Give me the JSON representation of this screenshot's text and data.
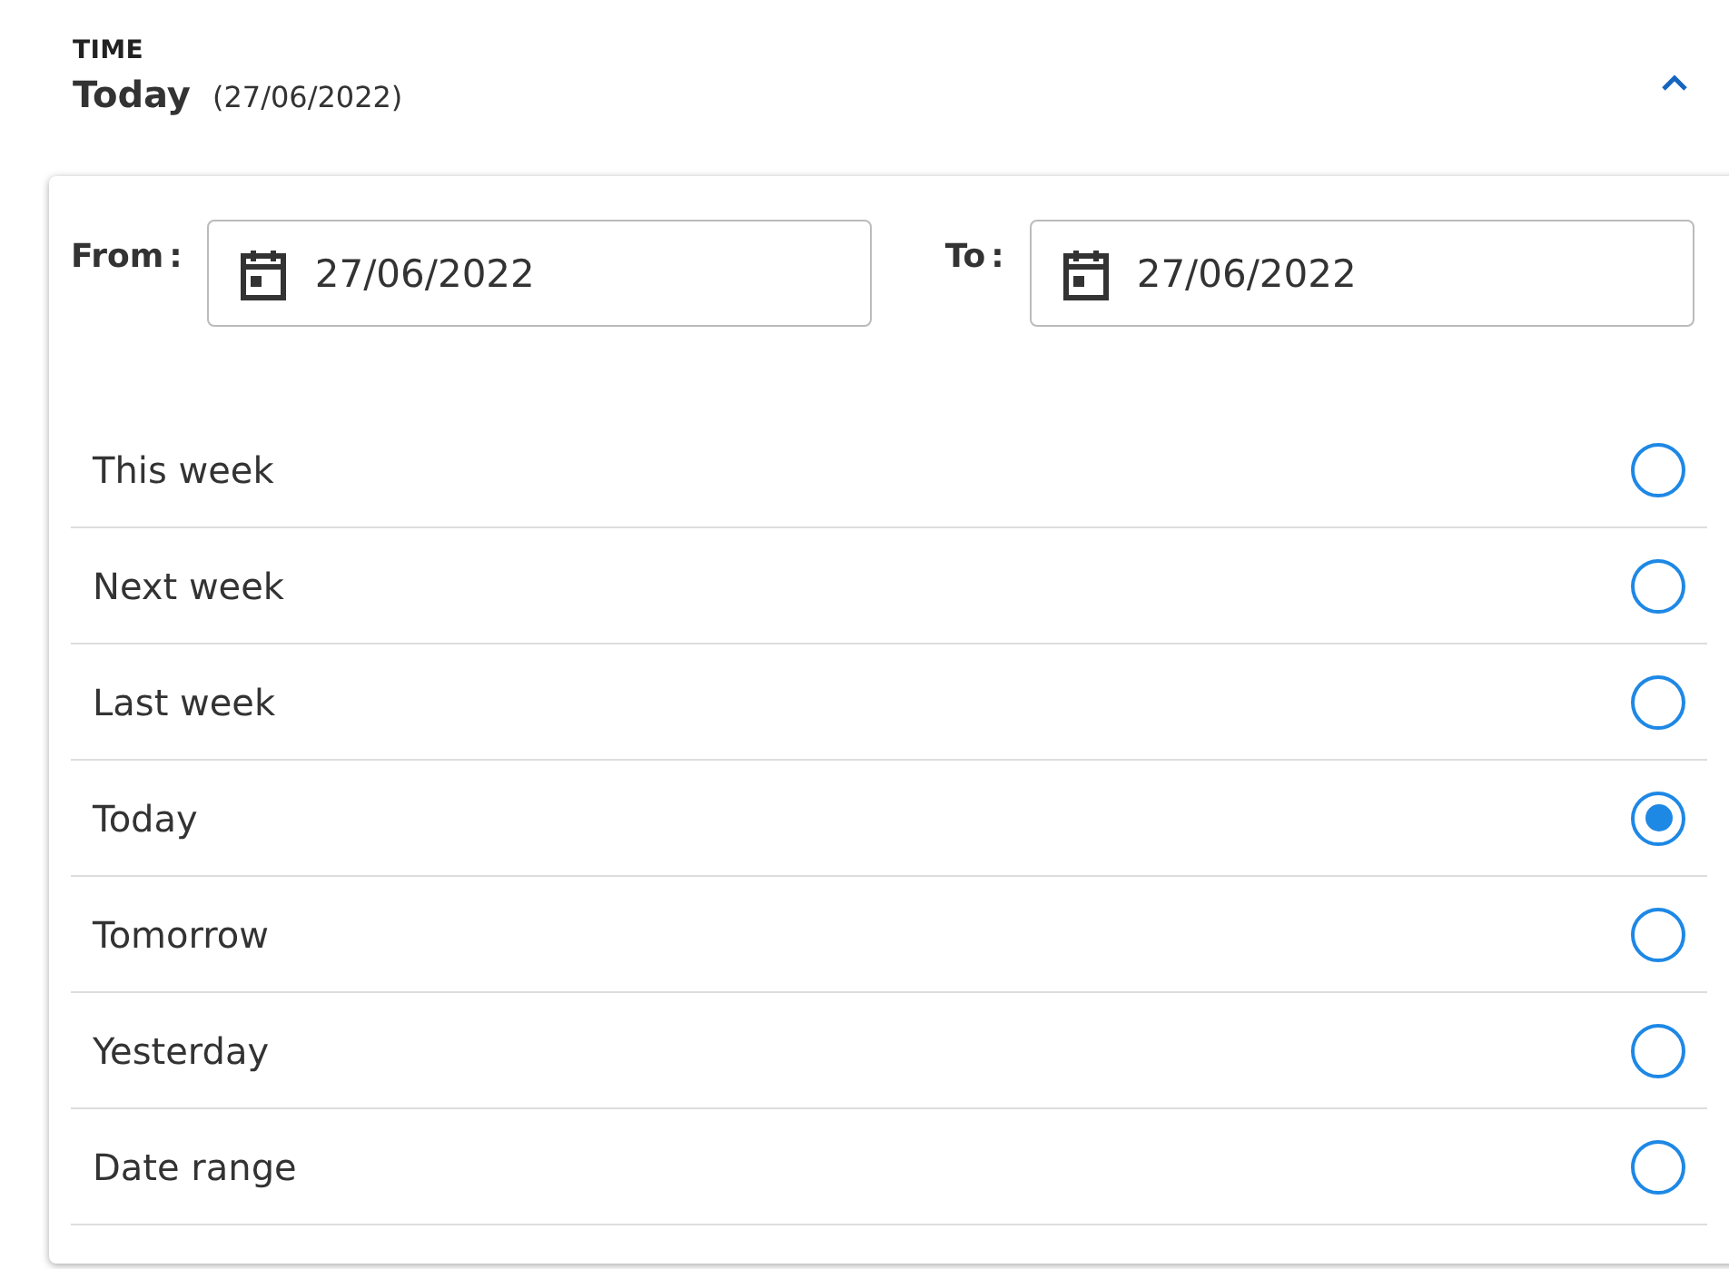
{
  "section": {
    "label": "TIME",
    "value": "Today",
    "date": "(27/06/2022)",
    "expanded": true
  },
  "range": [
    {
      "label": "From",
      "separator": ":",
      "value": "27/06/2022"
    },
    {
      "label": "To",
      "separator": ":",
      "value": "27/06/2022"
    }
  ],
  "options": [
    {
      "label": "This week",
      "selected": false
    },
    {
      "label": "Next week",
      "selected": false
    },
    {
      "label": "Last week",
      "selected": false
    },
    {
      "label": "Today",
      "selected": true
    },
    {
      "label": "Tomorrow",
      "selected": false
    },
    {
      "label": "Yesterday",
      "selected": false
    },
    {
      "label": "Date range",
      "selected": false
    }
  ]
}
